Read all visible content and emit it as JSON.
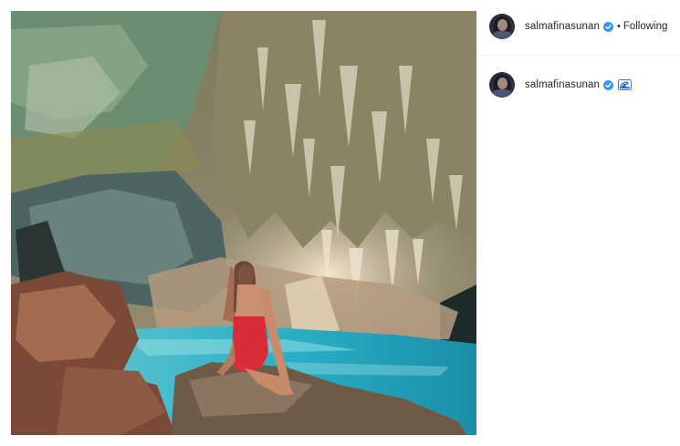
{
  "post": {
    "image_alt": "Woman in a red swimsuit sitting on a rock in a turquoise cave pool",
    "image_icon": "cave-photo"
  },
  "header": {
    "username": "salmafinasunan",
    "separator": "•",
    "follow_status": "Following",
    "verified_icon": "verified-badge-icon"
  },
  "comment": {
    "username": "salmafinasunan",
    "verified_icon": "verified-badge-icon",
    "emoji_icon": "wave-emoji-icon"
  },
  "colors": {
    "verified": "#3897f0",
    "text": "#262626",
    "divider": "#efefef"
  }
}
